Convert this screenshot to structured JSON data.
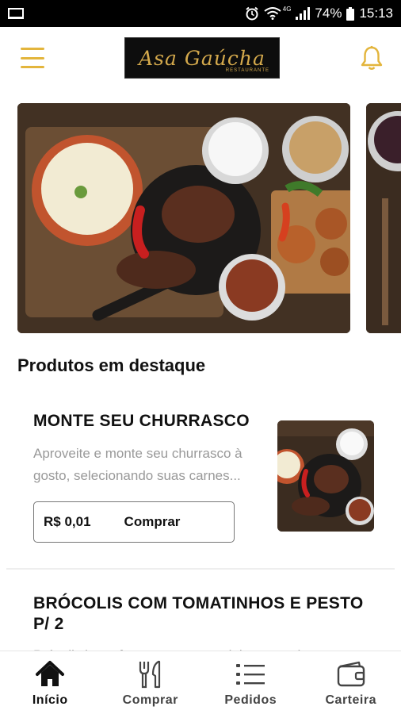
{
  "status_bar": {
    "battery": "74%",
    "time": "15:13",
    "network": "4G"
  },
  "header": {
    "logo_text": "Asa Gaúcha",
    "logo_subtext": "RESTAURANTE"
  },
  "section_title": "Produtos em destaque",
  "products": [
    {
      "title": "MONTE SEU CHURRASCO",
      "description": "Aproveite e monte seu churrasco à gosto, selecionando suas carnes...",
      "price": "R$ 0,01",
      "buy_label": "Comprar"
    },
    {
      "title": "BRÓCOLIS COM TOMATINHOS E PESTO P/ 2",
      "description": "Brócolis japonês no vapor, tomatinhos assados e..."
    }
  ],
  "bottom_nav": [
    {
      "label": "Início",
      "icon": "home-icon",
      "active": true
    },
    {
      "label": "Comprar",
      "icon": "cutlery-icon",
      "active": false
    },
    {
      "label": "Pedidos",
      "icon": "list-icon",
      "active": false
    },
    {
      "label": "Carteira",
      "icon": "wallet-icon",
      "active": false
    }
  ],
  "colors": {
    "accent": "#e3b53c",
    "logo_bg": "#0d0d0d",
    "logo_gold": "#d4a94c"
  }
}
